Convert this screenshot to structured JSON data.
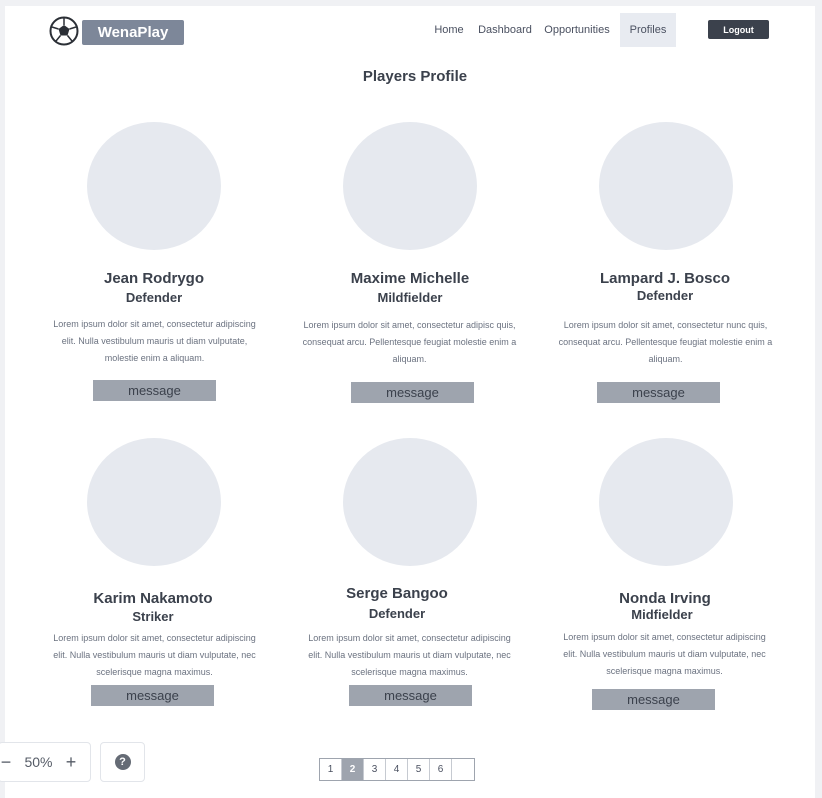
{
  "brand": {
    "name": "WenaPlay",
    "logo_icon": "soccer-ball-icon"
  },
  "nav": {
    "items": [
      {
        "label": "Home",
        "active": false
      },
      {
        "label": "Dashboard",
        "active": false
      },
      {
        "label": "Opportunities",
        "active": false
      },
      {
        "label": "Profiles",
        "active": true
      }
    ],
    "logout_label": "Logout"
  },
  "page": {
    "title": "Players Profile"
  },
  "players": [
    {
      "name": "Jean Rodrygo",
      "role": "Defender",
      "bio": "Lorem ipsum dolor sit amet, consectetur adipiscing elit. Nulla vestibulum mauris ut diam vulputate, molestie enim a aliquam.",
      "button": "message"
    },
    {
      "name": "Maxime Michelle",
      "role": "Mildfielder",
      "bio": "Lorem ipsum dolor sit amet, consectetur adipisc quis, consequat arcu. Pellentesque feugiat molestie enim a aliquam.",
      "button": "message"
    },
    {
      "name": "Lampard J. Bosco",
      "role": "Defender",
      "bio": "Lorem ipsum dolor sit amet, consectetur nunc quis, consequat arcu. Pellentesque feugiat molestie enim a aliquam.",
      "button": "message"
    },
    {
      "name": "Karim Nakamoto",
      "role": "Striker",
      "bio": "Lorem ipsum dolor sit amet, consectetur adipiscing elit. Nulla vestibulum mauris ut diam vulputate, nec scelerisque magna maximus.",
      "button": "message"
    },
    {
      "name": "Serge Bangoo",
      "role": "Defender",
      "bio": "Lorem ipsum dolor sit amet, consectetur adipiscing elit. Nulla vestibulum mauris ut diam vulputate, nec scelerisque magna maximus.",
      "button": "message"
    },
    {
      "name": "Nonda Irving",
      "role": "Midfielder",
      "bio": "Lorem ipsum dolor sit amet, consectetur adipiscing elit. Nulla vestibulum mauris ut diam vulputate, nec scelerisque magna maximus.",
      "button": "message"
    }
  ],
  "zoom": {
    "minus": "−",
    "level": "50%",
    "plus": "+"
  },
  "help": {
    "label": "?",
    "icon": "help-icon"
  },
  "pagination": {
    "pages": [
      "1",
      "2",
      "3",
      "4",
      "5",
      "6",
      ""
    ],
    "current": "2"
  },
  "colors": {
    "accent": "#7d8799",
    "logout_bg": "#3b414c",
    "button_bg": "#9ea4ae",
    "avatar_bg": "#e6e9ef"
  }
}
